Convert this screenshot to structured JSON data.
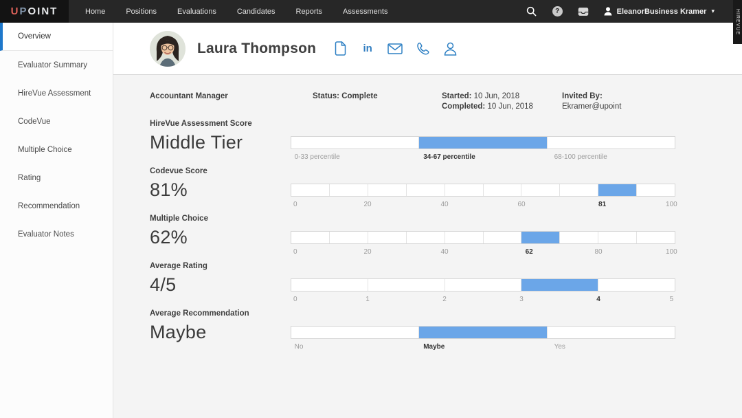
{
  "navbar": {
    "logo": {
      "part_u": "U",
      "part_p": "P",
      "part_rest": "OINT"
    },
    "items": [
      {
        "label": "Home"
      },
      {
        "label": "Positions"
      },
      {
        "label": "Evaluations"
      },
      {
        "label": "Candidates"
      },
      {
        "label": "Reports"
      },
      {
        "label": "Assessments"
      }
    ],
    "help_glyph": "?",
    "user_name": "EleanorBusiness Kramer",
    "chevron": "▾"
  },
  "watermark": "HIREVUE",
  "sidebar": {
    "items": [
      {
        "label": "Overview",
        "active": true
      },
      {
        "label": "Evaluator Summary",
        "active": false
      },
      {
        "label": "HireVue Assessment",
        "active": false
      },
      {
        "label": "CodeVue",
        "active": false
      },
      {
        "label": "Multiple Choice",
        "active": false
      },
      {
        "label": "Rating",
        "active": false
      },
      {
        "label": "Recommendation",
        "active": false
      },
      {
        "label": "Evaluator Notes",
        "active": false
      }
    ]
  },
  "header": {
    "candidate_name": "Laura Thompson",
    "linkedin_label": "in"
  },
  "info": {
    "position": "Accountant Manager",
    "status_label": "Status:",
    "status_value": "Complete",
    "started_label": "Started:",
    "started_value": "10 Jun, 2018",
    "completed_label": "Completed:",
    "completed_value": "10 Jun, 2018",
    "invited_by_label": "Invited By:",
    "invited_by_value": "Ekramer@upoint"
  },
  "chart_data": [
    {
      "type": "bar",
      "label": "HireVue Assessment Score",
      "value": "Middle Tier",
      "band": "34-67 percentile",
      "segments": 3,
      "filled_segment": 1,
      "ticks": [
        {
          "text": "0-33 percentile",
          "pos": 0.01,
          "bold": false,
          "align": "left"
        },
        {
          "text": "34-67 percentile",
          "pos": 0.345,
          "bold": true,
          "align": "left"
        },
        {
          "text": "68-100 percentile",
          "pos": 0.685,
          "bold": false,
          "align": "left"
        }
      ]
    },
    {
      "type": "bar",
      "label": "Codevue Score",
      "value": "81%",
      "numeric": 81,
      "range": [
        0,
        100
      ],
      "segments": 10,
      "filled_segment": 8,
      "ticks": [
        {
          "text": "0",
          "pos": 0.012,
          "bold": false
        },
        {
          "text": "20",
          "pos": 0.2,
          "bold": false
        },
        {
          "text": "40",
          "pos": 0.4,
          "bold": false
        },
        {
          "text": "60",
          "pos": 0.6,
          "bold": false
        },
        {
          "text": "81",
          "pos": 0.81,
          "bold": true
        },
        {
          "text": "100",
          "pos": 0.99,
          "bold": false
        }
      ]
    },
    {
      "type": "bar",
      "label": "Multiple Choice",
      "value": "62%",
      "numeric": 62,
      "range": [
        0,
        100
      ],
      "segments": 10,
      "filled_segment": 6,
      "ticks": [
        {
          "text": "0",
          "pos": 0.012,
          "bold": false
        },
        {
          "text": "20",
          "pos": 0.2,
          "bold": false
        },
        {
          "text": "40",
          "pos": 0.4,
          "bold": false
        },
        {
          "text": "62",
          "pos": 0.62,
          "bold": true
        },
        {
          "text": "80",
          "pos": 0.8,
          "bold": false
        },
        {
          "text": "100",
          "pos": 0.99,
          "bold": false
        }
      ]
    },
    {
      "type": "bar",
      "label": "Average Rating",
      "value": "4/5",
      "numeric": 4,
      "range": [
        0,
        5
      ],
      "segments": 5,
      "filled_segment": 3,
      "ticks": [
        {
          "text": "0",
          "pos": 0.012,
          "bold": false
        },
        {
          "text": "1",
          "pos": 0.2,
          "bold": false
        },
        {
          "text": "2",
          "pos": 0.4,
          "bold": false
        },
        {
          "text": "3",
          "pos": 0.6,
          "bold": false
        },
        {
          "text": "4",
          "pos": 0.8,
          "bold": true
        },
        {
          "text": "5",
          "pos": 0.99,
          "bold": false
        }
      ]
    },
    {
      "type": "bar",
      "label": "Average Recommendation",
      "value": "Maybe",
      "options": [
        "No",
        "Maybe",
        "Yes"
      ],
      "segments": 3,
      "filled_segment": 1,
      "ticks": [
        {
          "text": "No",
          "pos": 0.01,
          "bold": false,
          "align": "left"
        },
        {
          "text": "Maybe",
          "pos": 0.345,
          "bold": true,
          "align": "left"
        },
        {
          "text": "Yes",
          "pos": 0.685,
          "bold": false,
          "align": "left"
        }
      ]
    }
  ],
  "colors": {
    "accent_blue": "#6ba6e8",
    "active_tab_blue": "#1e78cb",
    "icon_blue": "#2e7cc0",
    "nav_bg": "#272727",
    "logo_bg": "#131313",
    "content_bg": "#f4f4f4"
  }
}
